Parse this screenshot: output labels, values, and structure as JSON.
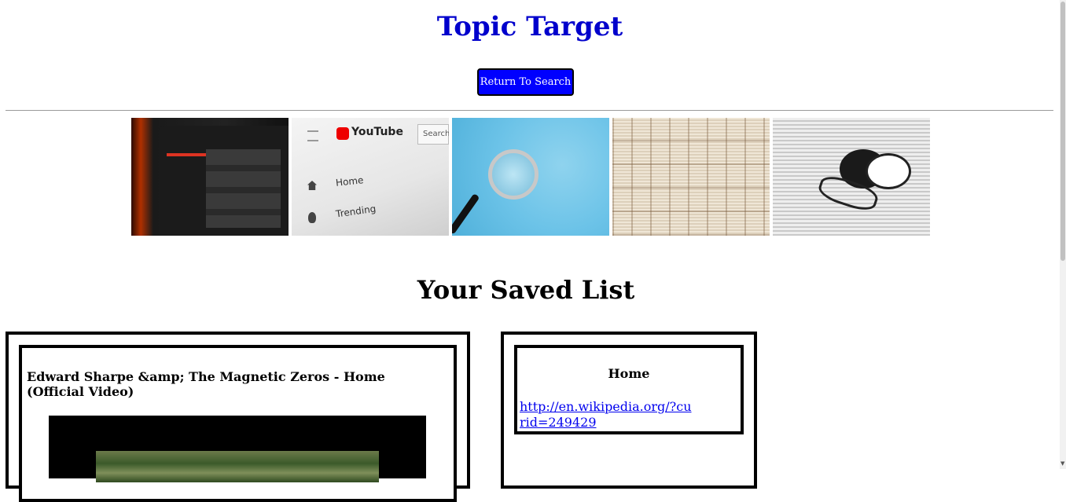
{
  "header": {
    "title": "Topic Target",
    "return_button": "Return To Search",
    "accent_color": "#0000cc",
    "button_color": "#0000ff"
  },
  "banner": {
    "images": [
      {
        "name": "youtube-on-monitor-photo"
      },
      {
        "name": "youtube-homepage-photo",
        "logo_text": "YouTube",
        "search_text": "Search",
        "nav_items": [
          "Home",
          "Trending"
        ]
      },
      {
        "name": "magnifying-glass-photo"
      },
      {
        "name": "book-pages-photo"
      },
      {
        "name": "newspaper-coffee-glasses-photo"
      }
    ]
  },
  "saved": {
    "title": "Your Saved List",
    "items": [
      {
        "title": "Edward Sharpe &amp; The Magnetic Zeros - Home (Official Video)",
        "type": "video"
      },
      {
        "title": "Home",
        "link": "http://en.wikipedia.org/?curid=249429"
      }
    ]
  }
}
